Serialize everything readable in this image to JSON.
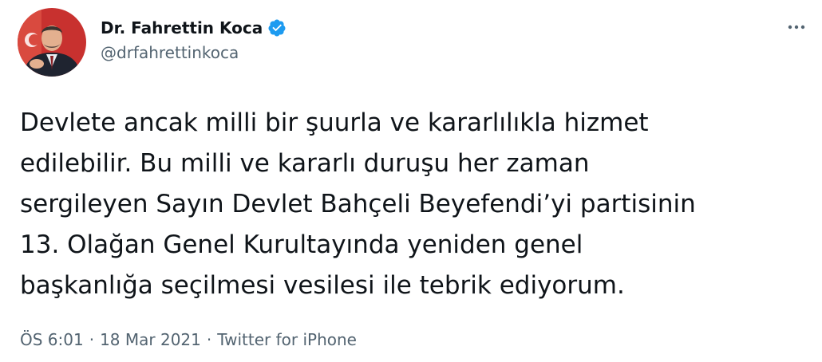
{
  "author": {
    "display_name": "Dr. Fahrettin Koca",
    "handle": "@drfahrettinkoca",
    "verified": true,
    "avatar_icon": "profile-photo",
    "verified_icon": "verified-badge-icon",
    "verified_color": "#1d9bf0"
  },
  "menu": {
    "icon": "more-horizontal-icon"
  },
  "tweet": {
    "text": "Devlete ancak milli bir şuurla ve kararlılıkla hizmet\nedilebilir. Bu milli ve kararlı duruşu her zaman\nsergileyen Sayın Devlet Bahçeli Beyefendi’yi partisinin\n13. Olağan Genel Kurultayında yeniden genel\nbaşkanlığa seçilmesi vesilesi ile tebrik ediyorum."
  },
  "meta": {
    "time": "ÖS 6:01",
    "separator": "·",
    "date": "18 Mar 2021",
    "source": "Twitter for iPhone"
  },
  "colors": {
    "text_primary": "#0f1419",
    "text_secondary": "#536471",
    "accent": "#1d9bf0"
  }
}
